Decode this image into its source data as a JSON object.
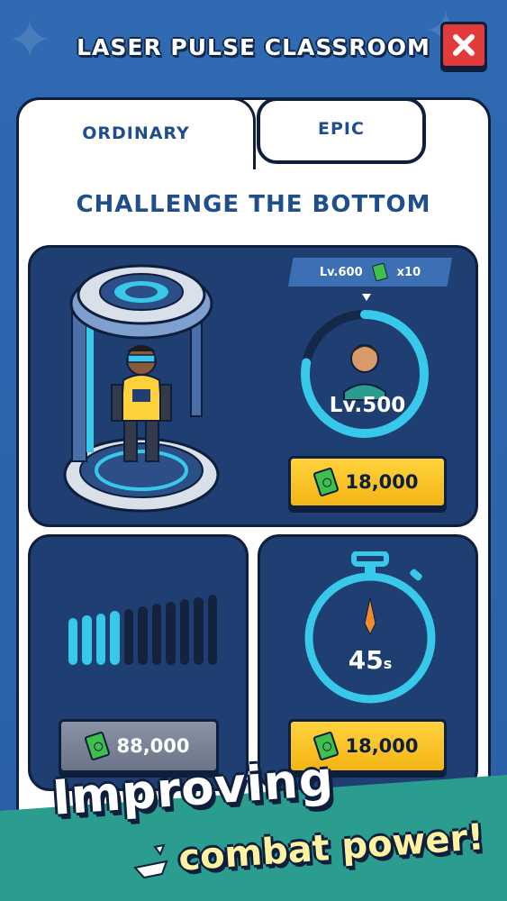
{
  "header": {
    "title": "LASER PULSE CLASSROOM"
  },
  "tabs": [
    {
      "label": "ORDINARY",
      "active": true
    },
    {
      "label": "EPIC",
      "active": false
    }
  ],
  "section_title": "CHALLENGE THE BOTTOM",
  "challenge": {
    "next_level": "Lv.600",
    "reward_multiplier": "x10",
    "current_level": "Lv.500",
    "progress": 0.78,
    "upgrade_cost": "18,000"
  },
  "power": {
    "bars_total": 11,
    "bars_filled": 4,
    "upgrade_cost": "88,000",
    "disabled": true
  },
  "timer": {
    "seconds": "45",
    "unit": "s",
    "upgrade_cost": "18,000"
  },
  "promo": {
    "line1": "Improving",
    "line2": "combat power!"
  },
  "colors": {
    "background": "#2f6ab3",
    "card": "#1f3e72",
    "accent_cyan": "#38c9ea",
    "button_yellow": "#ffd23d",
    "close_red": "#e23b3b",
    "title_blue": "#1f4e8c",
    "banner_green": "#2a9d8f"
  }
}
